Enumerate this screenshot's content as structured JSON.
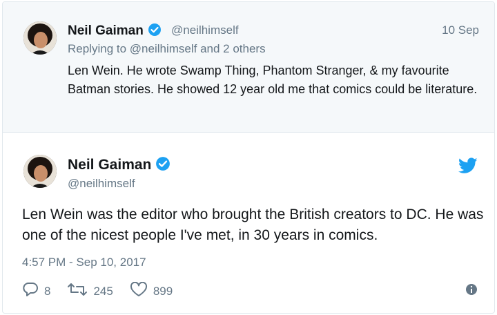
{
  "parent_tweet": {
    "author_name": "Neil Gaiman",
    "author_handle": "@neilhimself",
    "date": "10 Sep",
    "reply_context": "Replying to @neilhimself and 2 others",
    "text": "Len Wein. He wrote Swamp Thing, Phantom Stranger, & my favourite Batman stories. He showed 12 year old me that comics could be literature."
  },
  "main_tweet": {
    "author_name": "Neil Gaiman",
    "author_handle": "@neilhimself",
    "text": "Len Wein was the editor who brought the British creators to DC. He was one of the nicest people I've met, in 30 years in comics.",
    "timestamp": "4:57 PM - Sep 10, 2017",
    "reply_count": "8",
    "retweet_count": "245",
    "like_count": "899"
  },
  "icons": {
    "verified": "verified-badge-icon",
    "bird": "twitter-bird-icon",
    "reply": "reply-icon",
    "retweet": "retweet-icon",
    "like": "heart-icon",
    "info": "info-icon"
  },
  "colors": {
    "brand_blue": "#1da1f2",
    "muted_text": "#657786",
    "context_background": "#f5f8fa"
  }
}
